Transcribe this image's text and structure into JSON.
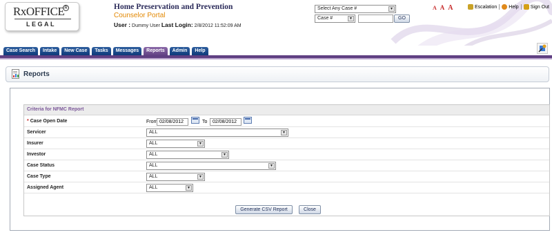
{
  "header": {
    "logo_brand": "RxOFFICE",
    "logo_sub": "LEGAL",
    "title": "Home Preservation and Prevention",
    "subtitle": "Counselor Portal",
    "user_label": "User :",
    "user_name": "Dummy User",
    "last_login_label": "Last Login:",
    "last_login_value": "2/8/2012 11:52:09 AM",
    "case_select": "Select Any Case #",
    "case_type_select": "Case #",
    "case_input": "",
    "go_button": "GO",
    "font_sizes": [
      "A",
      "A",
      "A"
    ],
    "links": [
      {
        "label": "Escalation",
        "icon": "escalation-icon",
        "color": "#c9a227"
      },
      {
        "label": "Help",
        "icon": "help-icon",
        "color": "#e08a1c"
      },
      {
        "label": "Sign Out",
        "icon": "lock-icon",
        "color": "#d4a017"
      }
    ]
  },
  "nav": {
    "tabs": [
      "Case Search",
      "Intake",
      "New Case",
      "Tasks",
      "Messages",
      "Reports",
      "Admin",
      "Help"
    ],
    "active_tab": "Reports"
  },
  "page": {
    "title": "Reports"
  },
  "criteria": {
    "heading": "Criteria for NFMC Report",
    "case_open_date": {
      "label": "Case Open Date",
      "from_label": "From",
      "from_value": "02/08/2012",
      "to_label": "To",
      "to_value": "02/08/2012"
    },
    "fields": [
      {
        "label": "Servicer",
        "value": "ALL"
      },
      {
        "label": "Insurer",
        "value": "ALL"
      },
      {
        "label": "Investor",
        "value": "ALL"
      },
      {
        "label": "Case Status",
        "value": "ALL"
      },
      {
        "label": "Case Type",
        "value": "ALL"
      },
      {
        "label": "Assigned Agent",
        "value": "ALL"
      }
    ]
  },
  "actions": {
    "generate": "Generate CSV Report",
    "close": "Close"
  },
  "colors": {
    "nav_tab": "#1c4a8a",
    "nav_active": "#6e4d91",
    "subtitle": "#e28700",
    "criteria_heading": "#7b5799"
  }
}
